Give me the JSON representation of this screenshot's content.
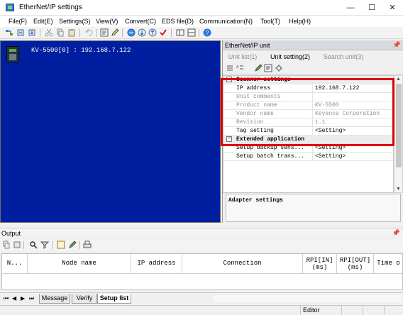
{
  "window": {
    "title": "EtherNet/IP settings",
    "minimize": "—",
    "maximize": "☐",
    "close": "✕"
  },
  "menu": [
    "File(F)",
    "Edit(E)",
    "Settings(S)",
    "View(V)",
    "Convert(C)",
    "EDS file(D)",
    "Communication(N)",
    "Tool(T)",
    "Help(H)"
  ],
  "tree": {
    "device_label": "KV-5500[0] : 192.168.7.122"
  },
  "panel": {
    "title": "EtherNet/IP unit",
    "tabs": [
      "Unit list(1)",
      "Unit setting(2)",
      "Search unit(3)"
    ],
    "scanner_header": "Scanner settings",
    "rows": [
      {
        "name": "IP address",
        "value": "192.168.7.122",
        "disabled": false
      },
      {
        "name": "Unit comments",
        "value": "",
        "disabled": true
      },
      {
        "name": "Product name",
        "value": "KV-5500",
        "disabled": true
      },
      {
        "name": "Vendor name",
        "value": "Keyence Corporation",
        "disabled": true
      },
      {
        "name": "Revision",
        "value": "1.1",
        "disabled": true
      },
      {
        "name": "Tag setting",
        "value": "<Setting>",
        "disabled": false
      }
    ],
    "other_header": "Extended application",
    "other_rows": [
      {
        "name": "Setup backup sens...",
        "value": "<Setting>"
      },
      {
        "name": "Setup batch trans...",
        "value": "<Setting>"
      }
    ],
    "description": "Adapter settings"
  },
  "output": {
    "title": "Output",
    "columns": [
      {
        "label": "N...",
        "lines": [
          "N..."
        ]
      },
      {
        "label": "Node name",
        "lines": [
          "Node name"
        ]
      },
      {
        "label": "IP address",
        "lines": [
          "IP address"
        ]
      },
      {
        "label": "Connection",
        "lines": [
          "Connection"
        ]
      },
      {
        "label": "RPI[IN] (ms)",
        "lines": [
          "RPI[IN]",
          "(ms)"
        ]
      },
      {
        "label": "RPI[OUT] (ms)",
        "lines": [
          "RPI[OUT]",
          "(ms)"
        ]
      },
      {
        "label": "Time o",
        "lines": [
          "Time o"
        ]
      }
    ],
    "tabs": [
      "Message",
      "Verify",
      "Setup list"
    ]
  },
  "status": {
    "mode": "Editor"
  },
  "icons": [
    "search-icon",
    "settings-icon",
    "save-icon",
    "add-icon",
    "delete-icon",
    "help-icon",
    "pin-icon"
  ]
}
